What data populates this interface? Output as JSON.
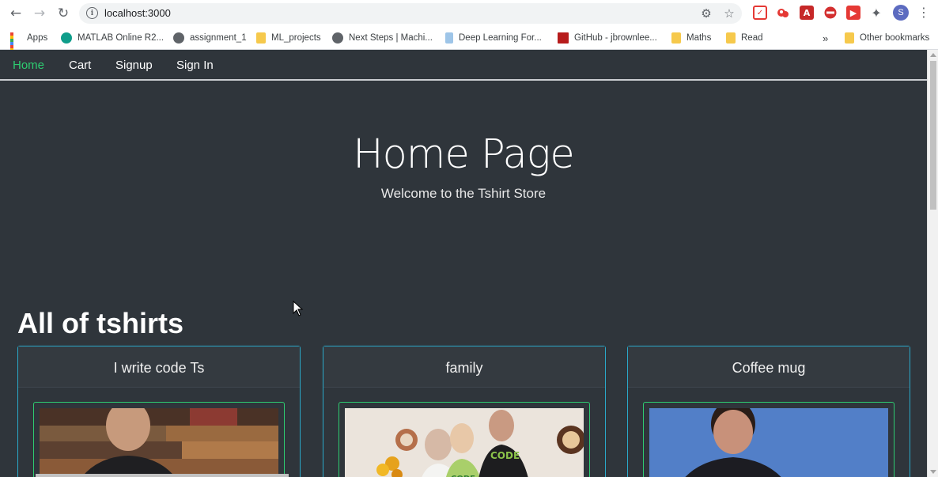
{
  "browser": {
    "url": "localhost:3000",
    "profile_initial": "S",
    "bookmarks": [
      {
        "label": "Apps",
        "icon": "apps-grid-icon"
      },
      {
        "label": "MATLAB Online R2...",
        "icon": "matlab-icon"
      },
      {
        "label": "assignment_1",
        "icon": "globe-icon"
      },
      {
        "label": "ML_projects",
        "icon": "folder-icon"
      },
      {
        "label": "Next Steps | Machi...",
        "icon": "globe-icon"
      },
      {
        "label": "Deep Learning For...",
        "icon": "deep-learning-icon"
      },
      {
        "label": "GitHub - jbrownlee...",
        "icon": "github-icon"
      },
      {
        "label": "Maths",
        "icon": "folder-icon"
      },
      {
        "label": "Read",
        "icon": "folder-icon"
      },
      {
        "label": "Other bookmarks",
        "icon": "folder-icon"
      }
    ],
    "overflow_label": "»"
  },
  "nav": {
    "items": [
      "Home",
      "Cart",
      "Signup",
      "Sign In"
    ],
    "active": "Home"
  },
  "hero": {
    "title": "Home Page",
    "subtitle": "Welcome to the Tshirt Store"
  },
  "products_section": {
    "title": "All of tshirts",
    "products": [
      {
        "name": "I write code Ts"
      },
      {
        "name": "family"
      },
      {
        "name": "Coffee mug"
      }
    ]
  },
  "colors": {
    "page_bg": "#2f353b",
    "active_link": "#2ecc71",
    "card_border": "#2aa9c9",
    "image_border": "#2ecc71"
  }
}
